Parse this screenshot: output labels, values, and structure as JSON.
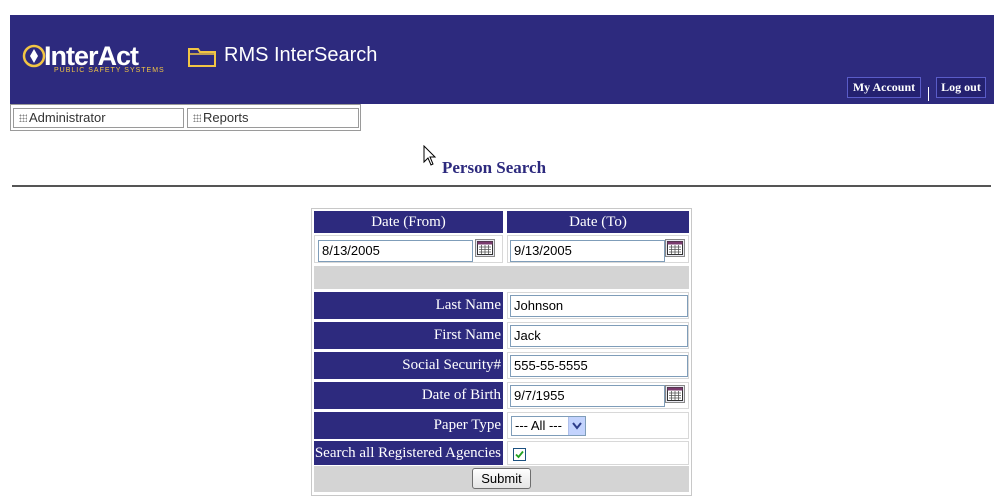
{
  "header": {
    "logo_text": "InterAct",
    "logo_subtext": "PUBLIC SAFETY SYSTEMS",
    "app_title": "RMS InterSearch",
    "my_account": "My Account",
    "log_out": "Log out",
    "bg_color": "#2d2a7e",
    "accent_color": "#f2c544"
  },
  "nav": {
    "items": [
      {
        "label": "Administrator"
      },
      {
        "label": "Reports"
      }
    ]
  },
  "page": {
    "title": "Person Search"
  },
  "form": {
    "date_from_label": "Date (From)",
    "date_to_label": "Date (To)",
    "date_from_value": "8/13/2005",
    "date_to_value": "9/13/2005",
    "fields": [
      {
        "label": "Last Name",
        "value": "Johnson"
      },
      {
        "label": "First Name",
        "value": "Jack"
      },
      {
        "label": "Social Security#",
        "value": "555-55-5555"
      },
      {
        "label": "Date of Birth",
        "value": "9/7/1955"
      }
    ],
    "paper_type_label": "Paper Type",
    "paper_type_value": "--- All ---",
    "search_all_label": "Search all Registered Agencies",
    "search_all_checked": true,
    "submit_label": "Submit"
  },
  "icons": {
    "calendar": "calendar-icon",
    "folder": "folder-icon",
    "dropdown": "chevron-down-icon",
    "check": "checkmark-icon"
  }
}
